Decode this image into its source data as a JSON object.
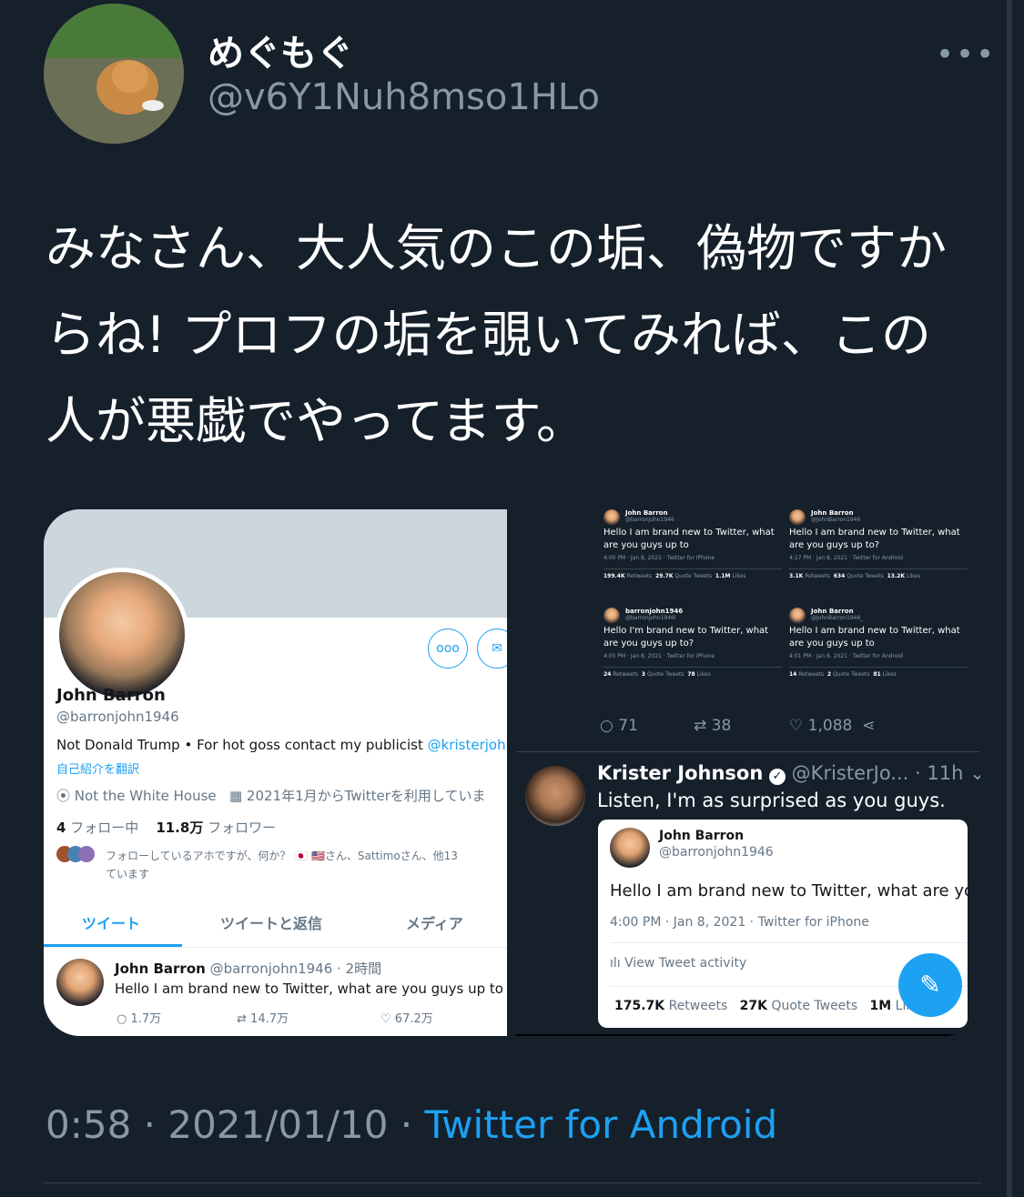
{
  "author": {
    "name": "めぐもぐ",
    "handle": "@v6Y1Nuh8mso1HLo"
  },
  "menu": {
    "more_label": "•••"
  },
  "tweet": {
    "text": "みなさん、大人気のこの垢、偽物ですからね! プロフの垢を覗いてみれば、この人が悪戯でやってます。"
  },
  "profile": {
    "name": "John Barron",
    "handle": "@barronjohn1946",
    "bio": "Not Donald Trump • For hot goss contact my publicist",
    "bio_link": "@kristerjohnsc",
    "translate": "自己紹介を翻訳",
    "location": "Not the White House",
    "joined": "2021年1月からTwitterを利用していま",
    "following_count": "4",
    "following_label": "フォロー中",
    "followers_count": "11.8万",
    "followers_label": "フォロワー",
    "followed_by": "フォローしているアホですが、何か？ 🇯🇵 🇺🇸さん、Sattimoさん、他13",
    "followed_by_2": "ています",
    "tabs": [
      "ツイート",
      "ツイートと返信",
      "メディア"
    ],
    "tweet": {
      "name": "John Barron",
      "handle": "@barronjohn1946 · 2時間",
      "text": "Hello I am brand new to Twitter, what are you guys up to",
      "replies": "1.7万",
      "retweets": "14.7万",
      "likes": "67.2万"
    }
  },
  "grid": [
    {
      "name": "John Barron",
      "handle": "@barronjohn1946",
      "text": "Hello I am brand new to Twitter, what are you guys up to",
      "meta": "4:00 PM · Jan 8, 2021 · Twitter for iPhone",
      "rt": "199.4K",
      "rt_label": "Retweets",
      "qt": "29.7K",
      "qt_label": "Quote Tweets",
      "lk": "1.1M",
      "lk_label": "Likes"
    },
    {
      "name": "John Barron",
      "handle": "@JohnBarron1946",
      "text": "Hello I am brand new to Twitter, what are you guys up to?",
      "meta": "4:17 PM · Jan 8, 2021 · Twitter for Android",
      "rt": "3.1K",
      "rt_label": "Retweets",
      "qt": "634",
      "qt_label": "Quote Tweets",
      "lk": "13.2K",
      "lk_label": "Likes"
    },
    {
      "name": "barronjohn1946",
      "handle": "@barronjohn1946l",
      "text": "Hello I'm brand new to Twitter, what are you guys up to?",
      "meta": "4:05 PM · Jan 8, 2021 · Twitter for iPhone",
      "rt": "24",
      "rt_label": "Retweets",
      "qt": "3",
      "qt_label": "Quote Tweets",
      "lk": "78",
      "lk_label": "Likes"
    },
    {
      "name": "John Barron",
      "handle": "@JohnBarron1946_",
      "text": "Hello I am brand new to Twitter, what are you guys up to",
      "meta": "4:01 PM · Jan 8, 2021 · Twitter for Android",
      "rt": "14",
      "rt_label": "Retweets",
      "qt": "2",
      "qt_label": "Quote Tweets",
      "lk": "81",
      "lk_label": "Likes"
    }
  ],
  "grid_actions": {
    "replies": "71",
    "retweets": "38",
    "likes": "1,088"
  },
  "krister": {
    "name": "Krister Johnson",
    "handle": "@KristerJo...",
    "time": "· 11h",
    "text": "Listen, I'm as surprised as you guys.",
    "quoted": {
      "name": "John Barron",
      "handle": "@barronjohn1946",
      "text": "Hello I am brand new to Twitter, what are you",
      "meta": "4:00 PM · Jan 8, 2021 · Twitter for iPhone",
      "activity": "View Tweet activity",
      "rt": "175.7K",
      "rt_label": "Retweets",
      "qt": "27K",
      "qt_label": "Quote Tweets",
      "lk": "1M",
      "lk_label": "Likes"
    }
  },
  "footer": {
    "time": "0:58 · 2021/01/10 · ",
    "source": "Twitter for Android"
  },
  "colors": {
    "bg": "#15202b",
    "accent": "#1da1f2",
    "muted": "#8899a6"
  }
}
